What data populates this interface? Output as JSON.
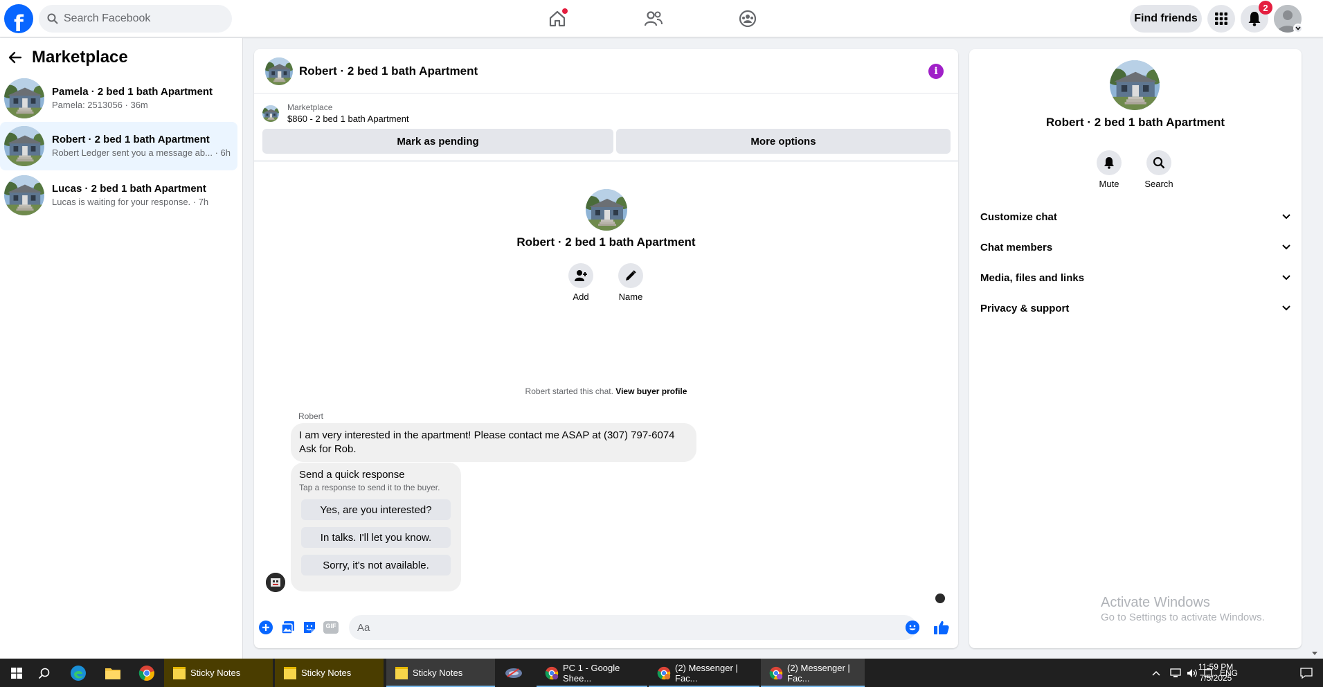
{
  "topbar": {
    "logo_letter": "f",
    "search_placeholder": "Search Facebook",
    "find_friends_label": "Find friends",
    "notifications_count": "2",
    "brand_color": "#0866ff"
  },
  "sidebar": {
    "title": "Marketplace",
    "conversations": [
      {
        "title": "Pamela · 2 bed 1 bath Apartment",
        "preview": "Pamela: 2513056 · 36m"
      },
      {
        "title": "Robert · 2 bed 1 bath Apartment",
        "preview": "Robert Ledger sent you a message ab... · 6h"
      },
      {
        "title": "Lucas · 2 bed 1 bath Apartment",
        "preview": "Lucas is waiting for your response. · 7h"
      }
    ]
  },
  "chat": {
    "title": "Robert · 2 bed 1 bath Apartment",
    "listing_source": "Marketplace",
    "listing_summary": "$860 - 2 bed 1 bath Apartment",
    "mark_pending_label": "Mark as pending",
    "more_options_label": "More options",
    "profile_name": "Robert · 2 bed 1 bath Apartment",
    "add_label": "Add",
    "name_label": "Name",
    "started_text": "Robert started this chat.",
    "view_buyer_profile": "View buyer profile",
    "sender_name": "Robert",
    "message_text": "I am very interested in the apartment! Please contact me ASAP at (307) 797-6074 Ask for Rob.",
    "quick_title": "Send a quick response",
    "quick_subtitle": "Tap a response to send it to the buyer.",
    "quick_responses": [
      "Yes, are you interested?",
      "In talks. I'll let you know.",
      "Sorry, it's not available."
    ],
    "composer_placeholder": "Aa",
    "gif_label": "GIF"
  },
  "details": {
    "name": "Robert · 2 bed 1 bath Apartment",
    "mute_label": "Mute",
    "search_label": "Search",
    "sections": [
      "Customize chat",
      "Chat members",
      "Media, files and links",
      "Privacy & support"
    ],
    "watermark_title": "Activate Windows",
    "watermark_sub": "Go to Settings to activate Windows."
  },
  "taskbar": {
    "apps": [
      "Sticky Notes",
      "Sticky Notes",
      "Sticky Notes",
      "PC 1 - Google Shee...",
      "(2) Messenger | Fac...",
      "(2) Messenger | Fac..."
    ],
    "lang": "ENG",
    "time": "11:59 PM",
    "date": "7/5/2025"
  }
}
